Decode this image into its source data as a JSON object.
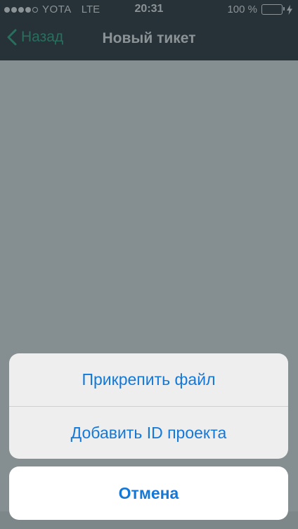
{
  "status_bar": {
    "carrier": "YOTA",
    "network": "LTE",
    "time": "20:31",
    "battery": "100 %",
    "signal_bars": 4,
    "signal_total": 5
  },
  "nav": {
    "back_label": "Назад",
    "title": "Новый тикет"
  },
  "action_sheet": {
    "options": [
      {
        "label": "Прикрепить файл"
      },
      {
        "label": "Добавить ID проекта"
      }
    ],
    "cancel_label": "Отмена"
  },
  "colors": {
    "accent": "#1478d8",
    "nav_back": "#2a6e5e",
    "topbar_bg": "#263238"
  },
  "icons": {
    "back": "chevron-left-icon",
    "battery": "battery-icon",
    "charging": "bolt-icon"
  }
}
